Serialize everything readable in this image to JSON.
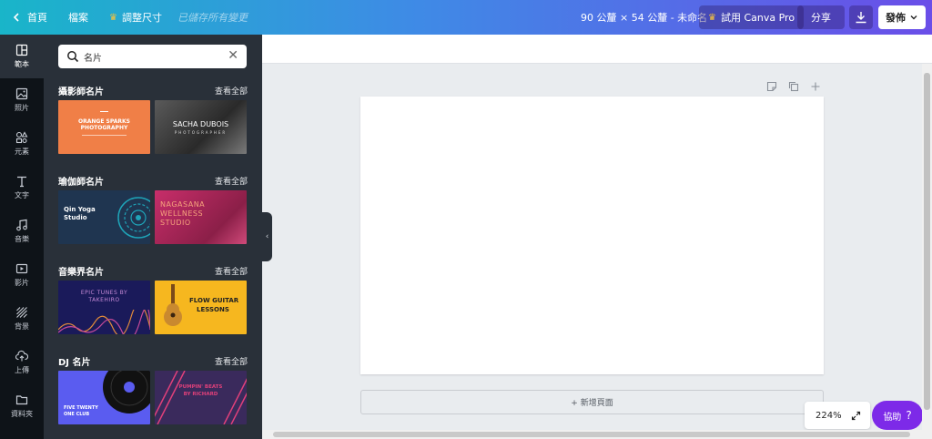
{
  "topbar": {
    "home_label": "首頁",
    "file_label": "檔案",
    "resize_label": "調整尺寸",
    "saved_status": "已儲存所有變更",
    "dimensions": "90 公釐 × 54 公釐 - 未命名",
    "pro_label": "試用 Canva Pro",
    "share_label": "分享",
    "publish_label": "發佈"
  },
  "rail": {
    "items": [
      {
        "label": "範本",
        "icon": "template-icon"
      },
      {
        "label": "照片",
        "icon": "photo-icon"
      },
      {
        "label": "元素",
        "icon": "elements-icon"
      },
      {
        "label": "文字",
        "icon": "text-icon"
      },
      {
        "label": "音樂",
        "icon": "music-icon"
      },
      {
        "label": "影片",
        "icon": "video-icon"
      },
      {
        "label": "背景",
        "icon": "background-icon"
      },
      {
        "label": "上傳",
        "icon": "upload-icon"
      },
      {
        "label": "資料夾",
        "icon": "folder-icon"
      }
    ]
  },
  "panel": {
    "search_value": "名片",
    "sections": [
      {
        "title": "攝影師名片",
        "see_all": "查看全部",
        "thumbs": [
          {
            "lines": [
              "ORANGE SPARKS",
              "PHOTOGRAPHY"
            ],
            "bg": "#f07f47"
          },
          {
            "lines": [
              "SACHA DUBOIS",
              "PHOTOGRAPHER"
            ],
            "bg": "#3a3a3a"
          }
        ]
      },
      {
        "title": "瑜伽師名片",
        "see_all": "查看全部",
        "thumbs": [
          {
            "lines": [
              "Qin Yoga",
              "Studio"
            ],
            "bg": "#1f3550"
          },
          {
            "lines": [
              "NAGASANA",
              "WELLNESS",
              "STUDIO"
            ],
            "bg": "#b3295c"
          }
        ]
      },
      {
        "title": "音樂界名片",
        "see_all": "查看全部",
        "thumbs": [
          {
            "lines": [
              "EPIC TUNES BY",
              "TAKEHIRO"
            ],
            "bg": "#1a1a5a"
          },
          {
            "lines": [
              "FLOW GUITAR",
              "LESSONS"
            ],
            "bg": "#f6b71f"
          }
        ]
      },
      {
        "title": "DJ 名片",
        "see_all": "查看全部",
        "thumbs": [
          {
            "lines": [
              "FIVE TWENTY",
              "ONE CLUB"
            ],
            "bg": "#5a5cf0"
          },
          {
            "lines": [
              "PUMPIN' BEATS",
              "BY RICHARD"
            ],
            "bg": "#3a2a5c"
          }
        ]
      }
    ]
  },
  "canvas": {
    "add_page_label": "+ 新增頁面"
  },
  "zoom": "224%",
  "help_label": "協助",
  "help_symbol": "?",
  "colors": {
    "accent": "#7d2ae8",
    "panel": "#293039",
    "rail": "#0e1318"
  }
}
